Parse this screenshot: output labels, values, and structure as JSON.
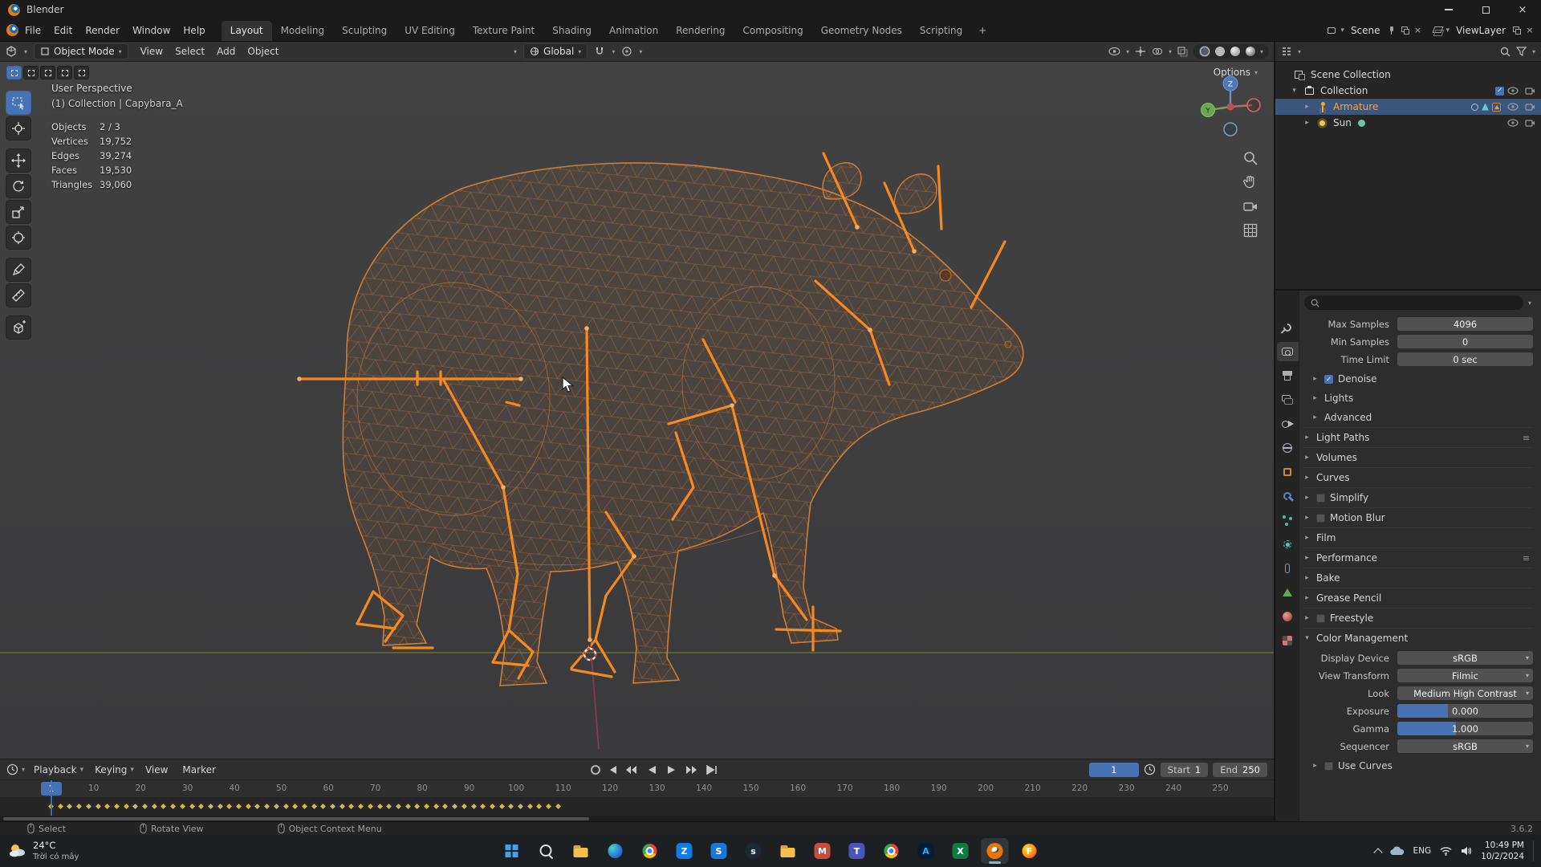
{
  "titlebar": {
    "app": "Blender"
  },
  "topbar": {
    "menus": [
      "File",
      "Edit",
      "Render",
      "Window",
      "Help"
    ],
    "workspaces": [
      {
        "label": "Layout",
        "active": true
      },
      {
        "label": "Modeling"
      },
      {
        "label": "Sculpting"
      },
      {
        "label": "UV Editing"
      },
      {
        "label": "Texture Paint"
      },
      {
        "label": "Shading"
      },
      {
        "label": "Animation"
      },
      {
        "label": "Rendering"
      },
      {
        "label": "Compositing"
      },
      {
        "label": "Geometry Nodes"
      },
      {
        "label": "Scripting"
      }
    ],
    "add_workspace": "+",
    "scene_label": "Scene",
    "viewlayer_label": "ViewLayer"
  },
  "viewport_header": {
    "mode": "Object Mode",
    "menus": [
      "View",
      "Select",
      "Add",
      "Object"
    ],
    "orientation": "Global",
    "options_label": "Options"
  },
  "viewport_overlay": {
    "perspective": "User Perspective",
    "context": "(1) Collection | Capybara_A",
    "stats": [
      {
        "label": "Objects",
        "value": "2 / 3"
      },
      {
        "label": "Vertices",
        "value": "19,752"
      },
      {
        "label": "Edges",
        "value": "39,274"
      },
      {
        "label": "Faces",
        "value": "19,530"
      },
      {
        "label": "Triangles",
        "value": "39,060"
      }
    ]
  },
  "gizmo": {
    "z": "Z",
    "y": "Y"
  },
  "outliner": {
    "items": [
      {
        "name": "outliner-item-scene-collection",
        "label": "Scene Collection",
        "icon": "ic-scene",
        "pad": "6px",
        "caret": ""
      },
      {
        "name": "outliner-item-collection",
        "label": "Collection",
        "icon": "ic-collection",
        "pad": "18px",
        "caret": "▾",
        "checkbox": true,
        "vis": true
      },
      {
        "name": "outliner-item-armature",
        "label": "Armature",
        "icon": "ic-armature",
        "pad": "34px",
        "caret": "▸",
        "selected": true,
        "orange": true,
        "badges_armature": true,
        "vis": true
      },
      {
        "name": "outliner-item-sun",
        "label": "Sun",
        "icon": "ic-light",
        "pad": "34px",
        "caret": "▸",
        "badges_light": true,
        "vis": true
      }
    ]
  },
  "properties": {
    "tabs": [
      {
        "name": "properties-tab-tool",
        "cls": "pt-tool"
      },
      {
        "name": "properties-tab-render",
        "cls": "pt-render",
        "active": true
      },
      {
        "name": "properties-tab-output",
        "cls": "pt-output"
      },
      {
        "name": "properties-tab-view-layer",
        "cls": "pt-viewlayer"
      },
      {
        "name": "properties-tab-scene",
        "cls": "pt-scene"
      },
      {
        "name": "properties-tab-world",
        "cls": "pt-world"
      },
      {
        "name": "properties-tab-object",
        "cls": "pt-object"
      },
      {
        "name": "properties-tab-modifiers",
        "cls": "pt-mod"
      },
      {
        "name": "properties-tab-particles",
        "cls": "pt-part"
      },
      {
        "name": "properties-tab-physics",
        "cls": "pt-phys"
      },
      {
        "name": "properties-tab-constraints",
        "cls": "pt-constr"
      },
      {
        "name": "properties-tab-object-data",
        "cls": "pt-data"
      },
      {
        "name": "properties-tab-material",
        "cls": "pt-mat"
      },
      {
        "name": "properties-tab-texture",
        "cls": "pt-tex"
      }
    ],
    "fields": [
      {
        "label": "Max Samples",
        "value": "4096"
      },
      {
        "label": "Min Samples",
        "value": "0"
      },
      {
        "label": "Time Limit",
        "value": "0 sec"
      }
    ],
    "denoise": {
      "label": "Denoise",
      "checked": true
    },
    "subsections": [
      {
        "label": "Lights"
      },
      {
        "label": "Advanced"
      }
    ],
    "panels": [
      {
        "label": "Light Paths",
        "menu": "≡"
      },
      {
        "label": "Volumes"
      },
      {
        "label": "Curves"
      },
      {
        "label": "Simplify",
        "checkbox": true
      },
      {
        "label": "Motion Blur",
        "checkbox": true
      },
      {
        "label": "Film"
      },
      {
        "label": "Performance",
        "menu": "≡"
      },
      {
        "label": "Bake"
      },
      {
        "label": "Grease Pencil"
      },
      {
        "label": "Freestyle",
        "checkbox": true
      }
    ],
    "color_management": {
      "label": "Color Management",
      "rows": [
        {
          "label": "Display Device",
          "value": "sRGB",
          "dropdown": true
        },
        {
          "label": "View Transform",
          "value": "Filmic",
          "dropdown": true
        },
        {
          "label": "Look",
          "value": "Medium High Contrast",
          "dropdown": true
        },
        {
          "label": "Exposure",
          "value": "0.000",
          "slider": true,
          "fill": "37%"
        },
        {
          "label": "Gamma",
          "value": "1.000",
          "slider": true,
          "fill": "43%"
        },
        {
          "label": "Sequencer",
          "value": "sRGB",
          "dropdown": true
        }
      ],
      "use_curves": {
        "label": "Use Curves"
      }
    }
  },
  "timeline": {
    "menus": [
      {
        "label": "Playback",
        "caret": "▾"
      },
      {
        "label": "Keying",
        "caret": "▾"
      },
      {
        "label": "View",
        "caret": ""
      },
      {
        "label": "Marker",
        "caret": ""
      }
    ],
    "current_frame": "1",
    "start_label": "Start",
    "start_value": "1",
    "end_label": "End",
    "end_value": "250",
    "ticks": [
      10,
      20,
      30,
      40,
      50,
      60,
      70,
      80,
      90,
      100,
      110,
      120,
      130,
      140,
      150,
      160,
      170,
      180,
      190,
      200,
      210,
      220,
      230,
      240,
      250
    ],
    "keyframes": {
      "from": 1,
      "to": 110,
      "step": 2
    }
  },
  "statusbar": {
    "items": [
      "Select",
      "Rotate View",
      "Object Context Menu"
    ],
    "version": "3.6.2"
  },
  "taskbar": {
    "weather_temp": "24°C",
    "weather_desc": "Trời có mây",
    "apps": [
      {
        "name": "taskbar-app-start",
        "cls": "app-start"
      },
      {
        "name": "taskbar-app-search",
        "cls": "app-search"
      },
      {
        "name": "taskbar-app-file-explorer",
        "cls": "app-folder"
      },
      {
        "name": "taskbar-app-edge",
        "cls": "app-edge"
      },
      {
        "name": "taskbar-app-chrome",
        "cls": "app-chrome"
      },
      {
        "name": "taskbar-app-zalo",
        "cls": "app-zalo",
        "glyph": "Z"
      },
      {
        "name": "taskbar-app-store",
        "cls": "app-store",
        "glyph": "S"
      },
      {
        "name": "taskbar-app-steam",
        "cls": "app-steam",
        "glyph": "s"
      },
      {
        "name": "taskbar-app-folder",
        "cls": "app-folder2"
      },
      {
        "name": "taskbar-app-mail",
        "cls": "app-mail",
        "glyph": "M"
      },
      {
        "name": "taskbar-app-teams",
        "cls": "app-teams",
        "glyph": "T"
      },
      {
        "name": "taskbar-app-browser",
        "cls": "app-chrome"
      },
      {
        "name": "taskbar-app-adobe",
        "cls": "app-adobe",
        "glyph": "A"
      },
      {
        "name": "taskbar-app-excel",
        "cls": "app-excel",
        "glyph": "X"
      },
      {
        "name": "taskbar-app-blender",
        "cls": "app-blender",
        "active": true
      },
      {
        "name": "taskbar-app-firefox",
        "cls": "app-firefox",
        "glyph": "F"
      }
    ],
    "tray": {
      "lang": "ENG",
      "time": "10:49 PM",
      "date": "10/2/2024"
    }
  },
  "icons": {
    "caret_down": "▾",
    "caret_right": "▸",
    "check": "✓",
    "close": "×",
    "chevron_up": "^"
  },
  "colors": {
    "accent_blue": "#4772b3",
    "selected_object_orange": "#f7a14c",
    "bone_orange": "#ff8d1f",
    "mesh_wire_orange": "#cf7d35",
    "keyframe_yellow": "#cdb84b"
  }
}
